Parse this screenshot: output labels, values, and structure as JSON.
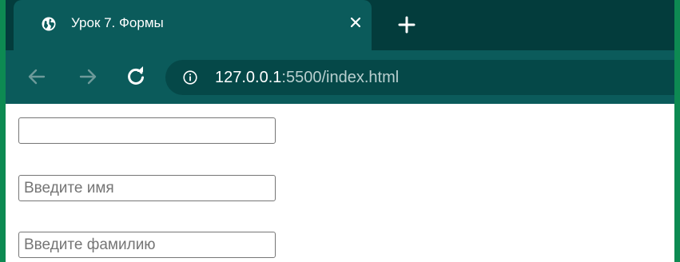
{
  "browser": {
    "tab": {
      "title": "Урок 7. Формы",
      "favicon": "globe-icon",
      "close_icon": "close-icon"
    },
    "new_tab_icon": "plus-icon",
    "toolbar": {
      "back_icon": "arrow-left-icon",
      "forward_icon": "arrow-right-icon",
      "reload_icon": "reload-icon",
      "info_icon": "info-icon",
      "url_host": "127.0.0.1",
      "url_rest": ":5500/index.html"
    }
  },
  "form": {
    "fields": [
      {
        "value": "",
        "placeholder": ""
      },
      {
        "value": "",
        "placeholder": "Введите имя"
      },
      {
        "value": "",
        "placeholder": "Введите фамилию"
      }
    ]
  },
  "colors": {
    "outer_border": "#0d8a52",
    "tabstrip_bg": "#033c3c",
    "tab_bg": "#0b5b5b",
    "omnibox_bg": "#054848",
    "page_bg": "#ffffff"
  }
}
